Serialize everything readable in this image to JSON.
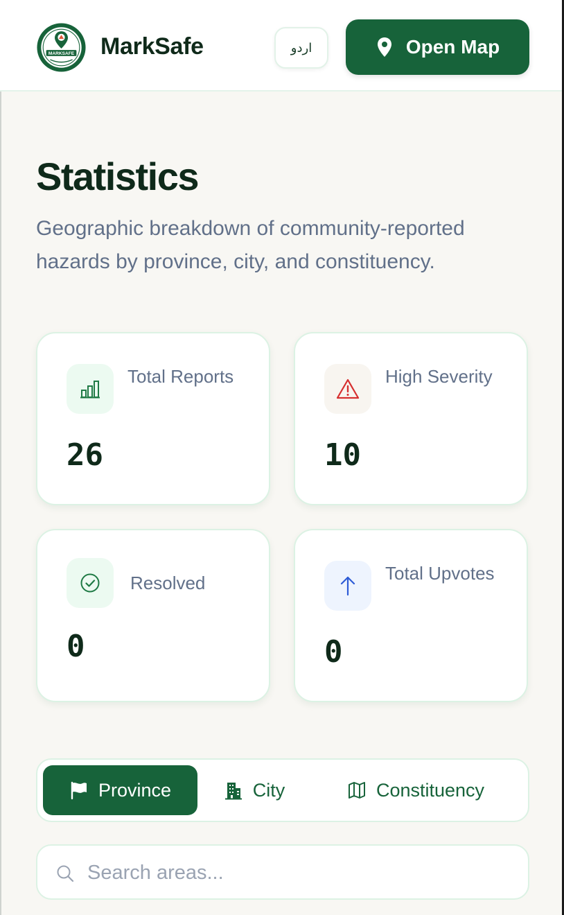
{
  "header": {
    "brand": "MarkSafe",
    "lang_toggle": "اردو",
    "open_map_label": "Open Map",
    "logo": {
      "top_text": "COMMUNITY-DRIVEN",
      "center_text": "MARKSAFE",
      "bottom_text": "HAZARD MAPPING PLATFORM"
    }
  },
  "page": {
    "title": "Statistics",
    "subtitle": "Geographic breakdown of community-reported hazards by province, city, and constituency."
  },
  "stats": [
    {
      "label": "Total Reports",
      "value": "26",
      "icon": "bar-chart-icon",
      "color": "#1f7a45",
      "bg": "#ecfaf1"
    },
    {
      "label": "High Severity",
      "value": "10",
      "icon": "warning-icon",
      "color": "#d62f2f",
      "bg": "#f8f5f0"
    },
    {
      "label": "Resolved",
      "value": "0",
      "icon": "check-circle-icon",
      "color": "#1f7a45",
      "bg": "#ecfaf1"
    },
    {
      "label": "Total Upvotes",
      "value": "0",
      "icon": "arrow-up-icon",
      "color": "#2d5bd6",
      "bg": "#eef4fe"
    }
  ],
  "tabs": [
    {
      "label": "Province",
      "icon": "flag-icon",
      "active": true
    },
    {
      "label": "City",
      "icon": "building-icon",
      "active": false
    },
    {
      "label": "Constituency",
      "icon": "map-icon",
      "active": false
    }
  ],
  "search": {
    "placeholder": "Search areas...",
    "value": ""
  },
  "colors": {
    "primary": "#17633a",
    "text": "#0f2a1a",
    "muted": "#617089",
    "background": "#f8f7f3"
  }
}
